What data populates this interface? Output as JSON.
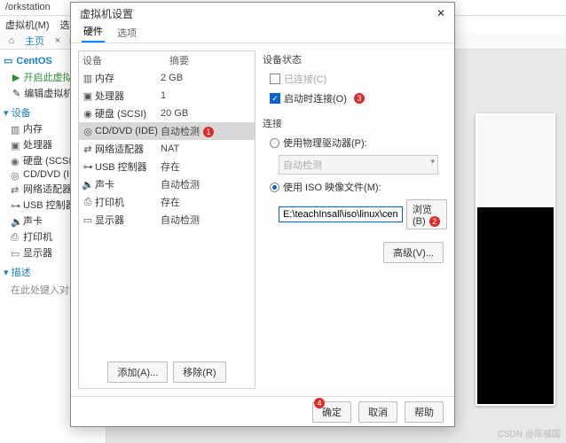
{
  "back": {
    "title": "/orkstation",
    "menu": {
      "vm": "虚拟机(M)",
      "tabs": "选项卡(T)"
    },
    "toolbar": {
      "home": "主页",
      "tab": "C"
    },
    "side": {
      "vm_name": "CentOS",
      "power_on": "开启此虚拟机",
      "edit": "编辑虚拟机设",
      "group_dev": "设备",
      "items": [
        {
          "name": "内存"
        },
        {
          "name": "处理器"
        },
        {
          "name": "硬盘 (SCSI)"
        },
        {
          "name": "CD/DVD (ID"
        },
        {
          "name": "网络适配器"
        },
        {
          "name": "USB 控制器"
        },
        {
          "name": "声卡"
        },
        {
          "name": "打印机"
        },
        {
          "name": "显示器"
        }
      ],
      "group_desc": "描述",
      "desc_hint": "在此处键入对该虚"
    }
  },
  "dialog": {
    "title": "虚拟机设置",
    "tabs": {
      "hw": "硬件",
      "opt": "选项"
    },
    "cols": {
      "device": "设备",
      "summary": "摘要"
    },
    "devices": [
      {
        "name": "内存",
        "summary": "2 GB"
      },
      {
        "name": "处理器",
        "summary": "1"
      },
      {
        "name": "硬盘 (SCSI)",
        "summary": "20 GB"
      },
      {
        "name": "CD/DVD (IDE)",
        "summary": "自动检测",
        "selected": true,
        "marker": "1"
      },
      {
        "name": "网络适配器",
        "summary": "NAT"
      },
      {
        "name": "USB 控制器",
        "summary": "存在"
      },
      {
        "name": "声卡",
        "summary": "自动检测"
      },
      {
        "name": "打印机",
        "summary": "存在"
      },
      {
        "name": "显示器",
        "summary": "自动检测"
      }
    ],
    "btn_add": "添加(A)...",
    "btn_remove": "移除(R)",
    "status": {
      "title": "设备状态",
      "connected": "已连接(C)",
      "connect_on": "启动时连接(O)",
      "marker": "3"
    },
    "connect": {
      "title": "连接",
      "use_phys": "使用物理驱动器(P):",
      "auto": "自动检测",
      "use_iso": "使用 ISO 映像文件(M):",
      "path": "E:\\teachInsall\\iso\\linux\\centOS",
      "browse": "浏览(B)",
      "browse_marker": "2",
      "advanced": "高级(V)..."
    },
    "footer": {
      "ok": "确定",
      "ok_marker": "4",
      "cancel": "取消",
      "help": "帮助"
    }
  },
  "watermark": "CSDN @陈福国"
}
